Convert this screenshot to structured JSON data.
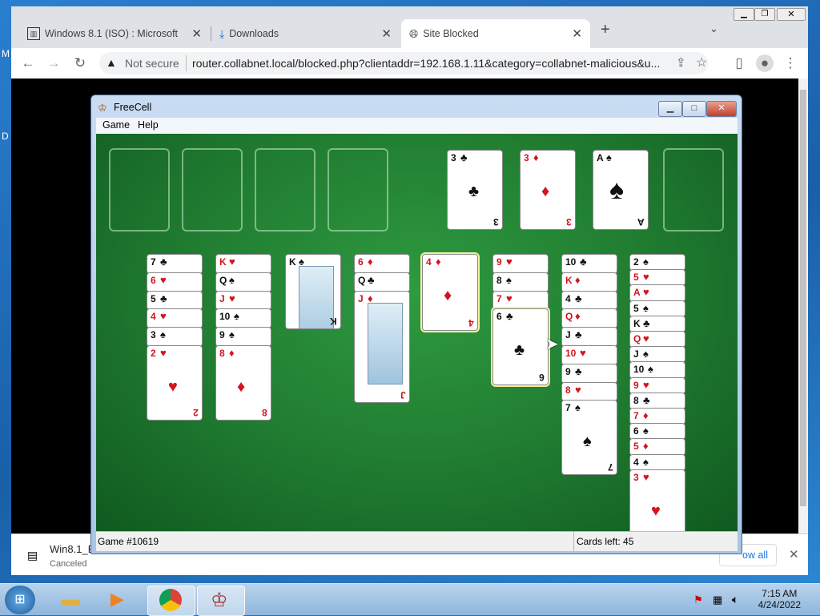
{
  "desktop": {
    "edge_letters": [
      "M",
      "D"
    ]
  },
  "browser": {
    "tabs": [
      {
        "label": "Windows 8.1 (ISO) : Microsoft : Fr",
        "icon": "archive-icon",
        "active": false
      },
      {
        "label": "Downloads",
        "icon": "download-icon",
        "active": false
      },
      {
        "label": "Site Blocked",
        "icon": "globe-icon",
        "active": true
      }
    ],
    "new_tab_symbol": "+",
    "security_label": "Not secure",
    "url": "router.collabnet.local/blocked.php?clientaddr=192.168.1.11&category=collabnet-malicious&u...",
    "download": {
      "filename": "Win8.1_E",
      "status": "Canceled",
      "show_all_label": "ow all"
    }
  },
  "freecell": {
    "title": "FreeCell",
    "menu": [
      "Game",
      "Help"
    ],
    "status_game": "Game #10619",
    "status_cards": "Cards left: 45",
    "free_cells": [
      null,
      null,
      null,
      null
    ],
    "foundations": [
      {
        "rank": "3",
        "suit": "♣",
        "color": "black"
      },
      {
        "rank": "3",
        "suit": "♦",
        "color": "red"
      },
      {
        "rank": "A",
        "suit": "♠",
        "color": "black"
      },
      null
    ],
    "columns": [
      [
        {
          "rank": "7",
          "suit": "♣",
          "color": "black"
        },
        {
          "rank": "6",
          "suit": "♥",
          "color": "red"
        },
        {
          "rank": "5",
          "suit": "♣",
          "color": "black"
        },
        {
          "rank": "4",
          "suit": "♥",
          "color": "red"
        },
        {
          "rank": "3",
          "suit": "♠",
          "color": "black"
        },
        {
          "rank": "2",
          "suit": "♥",
          "color": "red"
        }
      ],
      [
        {
          "rank": "K",
          "suit": "♥",
          "color": "red"
        },
        {
          "rank": "Q",
          "suit": "♠",
          "color": "black"
        },
        {
          "rank": "J",
          "suit": "♥",
          "color": "red"
        },
        {
          "rank": "10",
          "suit": "♠",
          "color": "black"
        },
        {
          "rank": "9",
          "suit": "♠",
          "color": "black"
        },
        {
          "rank": "8",
          "suit": "♦",
          "color": "red"
        }
      ],
      [
        {
          "rank": "K",
          "suit": "♠",
          "color": "black"
        }
      ],
      [
        {
          "rank": "6",
          "suit": "♦",
          "color": "red"
        },
        {
          "rank": "Q",
          "suit": "♣",
          "color": "black"
        },
        {
          "rank": "J",
          "suit": "♦",
          "color": "red"
        }
      ],
      [
        {
          "rank": "4",
          "suit": "♦",
          "color": "red"
        }
      ],
      [
        {
          "rank": "9",
          "suit": "♥",
          "color": "red"
        },
        {
          "rank": "8",
          "suit": "♠",
          "color": "black"
        },
        {
          "rank": "7",
          "suit": "♥",
          "color": "red"
        },
        {
          "rank": "6",
          "suit": "♣",
          "color": "black"
        }
      ],
      [
        {
          "rank": "10",
          "suit": "♣",
          "color": "black"
        },
        {
          "rank": "K",
          "suit": "♦",
          "color": "red"
        },
        {
          "rank": "4",
          "suit": "♣",
          "color": "black"
        },
        {
          "rank": "Q",
          "suit": "♦",
          "color": "red"
        },
        {
          "rank": "J",
          "suit": "♣",
          "color": "black"
        },
        {
          "rank": "10",
          "suit": "♥",
          "color": "red"
        },
        {
          "rank": "9",
          "suit": "♣",
          "color": "black"
        },
        {
          "rank": "8",
          "suit": "♥",
          "color": "red"
        },
        {
          "rank": "7",
          "suit": "♠",
          "color": "black"
        }
      ],
      [
        {
          "rank": "2",
          "suit": "♠",
          "color": "black"
        },
        {
          "rank": "5",
          "suit": "♥",
          "color": "red"
        },
        {
          "rank": "A",
          "suit": "♥",
          "color": "red"
        },
        {
          "rank": "5",
          "suit": "♠",
          "color": "black"
        },
        {
          "rank": "K",
          "suit": "♣",
          "color": "black"
        },
        {
          "rank": "Q",
          "suit": "♥",
          "color": "red"
        },
        {
          "rank": "J",
          "suit": "♠",
          "color": "black"
        },
        {
          "rank": "10",
          "suit": "♠",
          "color": "black"
        },
        {
          "rank": "9",
          "suit": "♥",
          "color": "red"
        },
        {
          "rank": "8",
          "suit": "♣",
          "color": "black"
        },
        {
          "rank": "7",
          "suit": "♦",
          "color": "red"
        },
        {
          "rank": "6",
          "suit": "♠",
          "color": "black"
        },
        {
          "rank": "5",
          "suit": "♦",
          "color": "red"
        },
        {
          "rank": "4",
          "suit": "♠",
          "color": "black"
        },
        {
          "rank": "3",
          "suit": "♥",
          "color": "red"
        }
      ]
    ]
  },
  "taskbar": {
    "apps": [
      "start-orb",
      "explorer",
      "media-player",
      "chrome",
      "freecell"
    ],
    "time": "7:15 AM",
    "date": "4/24/2022"
  }
}
